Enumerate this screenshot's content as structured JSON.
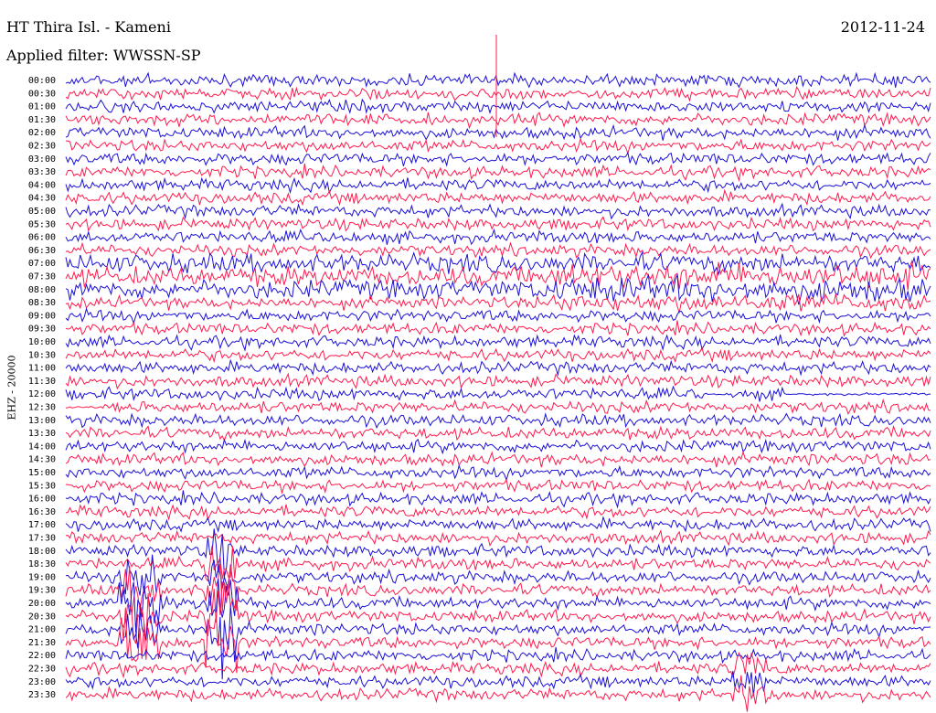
{
  "header": {
    "station": "HT Thira Isl. - Kameni",
    "filter": "Applied filter: WWSSN-SP",
    "date": "2012-11-24"
  },
  "chart_data": {
    "type": "line",
    "title": "HT Thira Isl. - Kameni",
    "subtitle": "Applied filter: WWSSN-SP",
    "ylabel": "EHZ - 20000",
    "row_labels": [
      "00:00",
      "00:30",
      "01:00",
      "01:30",
      "02:00",
      "02:30",
      "03:00",
      "03:30",
      "04:00",
      "04:30",
      "05:00",
      "05:30",
      "06:00",
      "06:30",
      "07:00",
      "07:30",
      "08:00",
      "08:30",
      "09:00",
      "09:30",
      "10:00",
      "10:30",
      "11:00",
      "11:30",
      "12:00",
      "12:30",
      "13:00",
      "13:30",
      "14:00",
      "14:30",
      "15:00",
      "15:30",
      "16:00",
      "16:30",
      "17:00",
      "17:30",
      "18:00",
      "18:30",
      "19:00",
      "19:30",
      "20:00",
      "20:30",
      "21:00",
      "21:30",
      "22:00",
      "22:30",
      "23:00",
      "23:30"
    ],
    "row_colors": [
      "#1b10d6",
      "#ff1a4d"
    ],
    "description_note": "Helicorder; each row is a 30-minute trace of the EHZ channel, colors alternating blue/red."
  }
}
